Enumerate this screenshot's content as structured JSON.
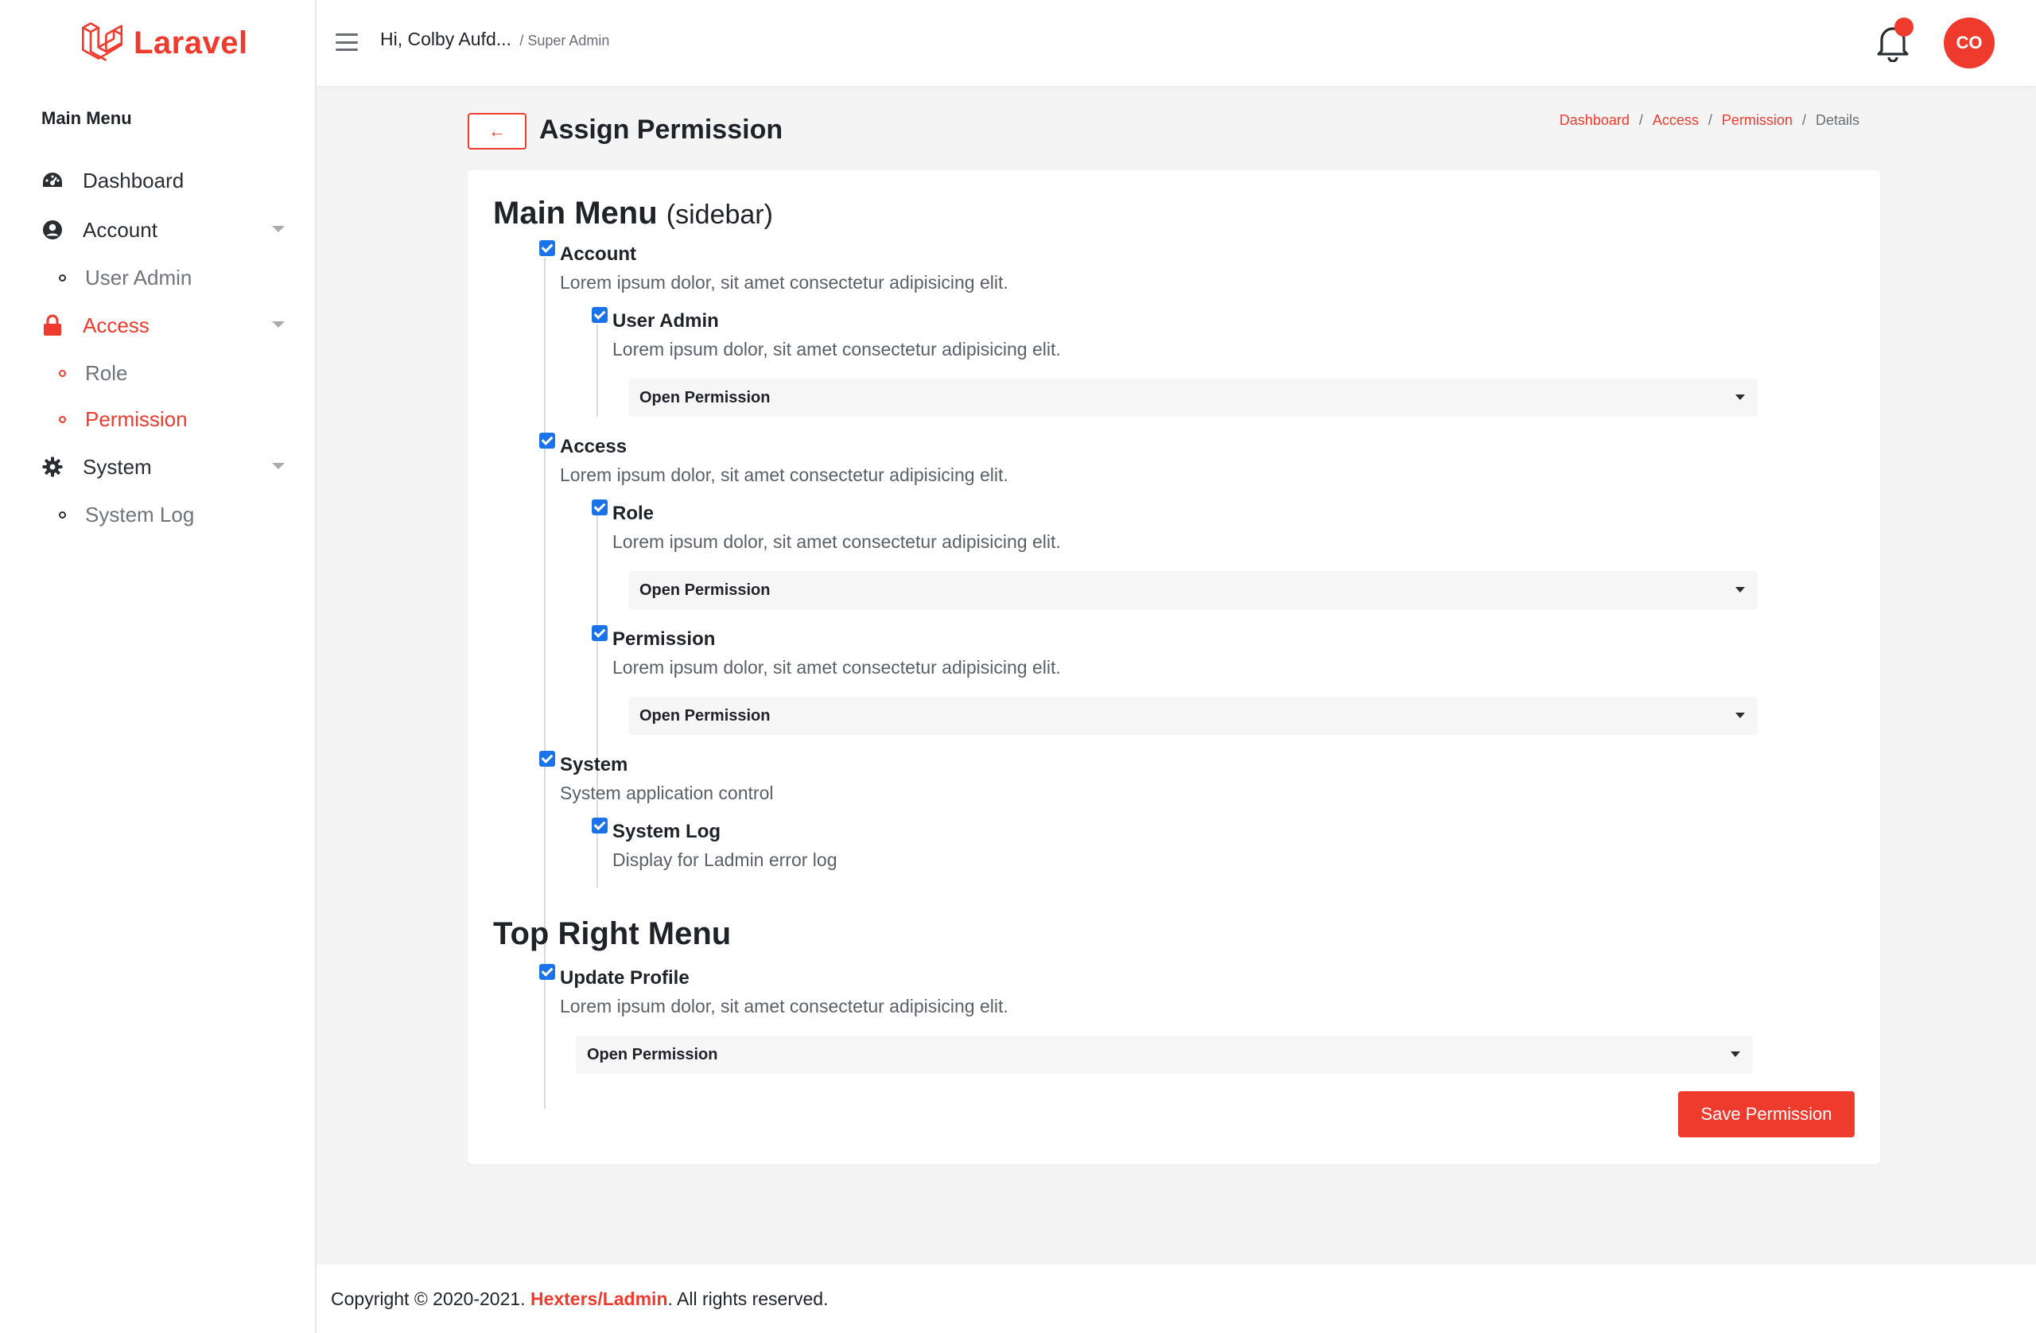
{
  "brand": {
    "name": "Laravel",
    "color": "#ef3b2d"
  },
  "sidebar": {
    "heading": "Main Menu",
    "items": [
      {
        "label": "Dashboard",
        "icon": "speedometer-icon"
      },
      {
        "label": "Account",
        "icon": "user-circle-icon",
        "children": [
          {
            "label": "User Admin"
          }
        ]
      },
      {
        "label": "Access",
        "icon": "lock-icon",
        "active": true,
        "children": [
          {
            "label": "Role"
          },
          {
            "label": "Permission",
            "current": true
          }
        ]
      },
      {
        "label": "System",
        "icon": "gear-icon",
        "children": [
          {
            "label": "System Log"
          }
        ]
      }
    ]
  },
  "topbar": {
    "greeting": "Hi, Colby Aufd...",
    "role": "/ Super Admin",
    "avatar_initials": "CO"
  },
  "page": {
    "back_label": "←",
    "title": "Assign Permission",
    "breadcrumb": [
      "Dashboard",
      "Access",
      "Permission",
      "Details"
    ]
  },
  "sections": {
    "main_menu": {
      "title": "Main Menu",
      "title_suffix": "(sidebar)",
      "nodes": {
        "account": {
          "title": "Account",
          "desc": "Lorem ipsum dolor, sit amet consectetur adipisicing elit."
        },
        "user_admin": {
          "title": "User Admin",
          "desc": "Lorem ipsum dolor, sit amet consectetur adipisicing elit.",
          "select": "Open Permission"
        },
        "access": {
          "title": "Access",
          "desc": "Lorem ipsum dolor, sit amet consectetur adipisicing elit."
        },
        "role": {
          "title": "Role",
          "desc": "Lorem ipsum dolor, sit amet consectetur adipisicing elit.",
          "select": "Open Permission"
        },
        "permission": {
          "title": "Permission",
          "desc": "Lorem ipsum dolor, sit amet consectetur adipisicing elit.",
          "select": "Open Permission"
        },
        "system": {
          "title": "System",
          "desc": "System application control"
        },
        "system_log": {
          "title": "System Log",
          "desc": "Display for Ladmin error log"
        }
      }
    },
    "top_right_menu": {
      "title": "Top Right Menu",
      "nodes": {
        "update_profile": {
          "title": "Update Profile",
          "desc": "Lorem ipsum dolor, sit amet consectetur adipisicing elit.",
          "select": "Open Permission"
        }
      }
    }
  },
  "save_label": "Save Permission",
  "footer": {
    "prefix": "Copyright © 2020-2021.",
    "brand": "Hexters/Ladmin",
    "suffix": ". All rights reserved."
  }
}
